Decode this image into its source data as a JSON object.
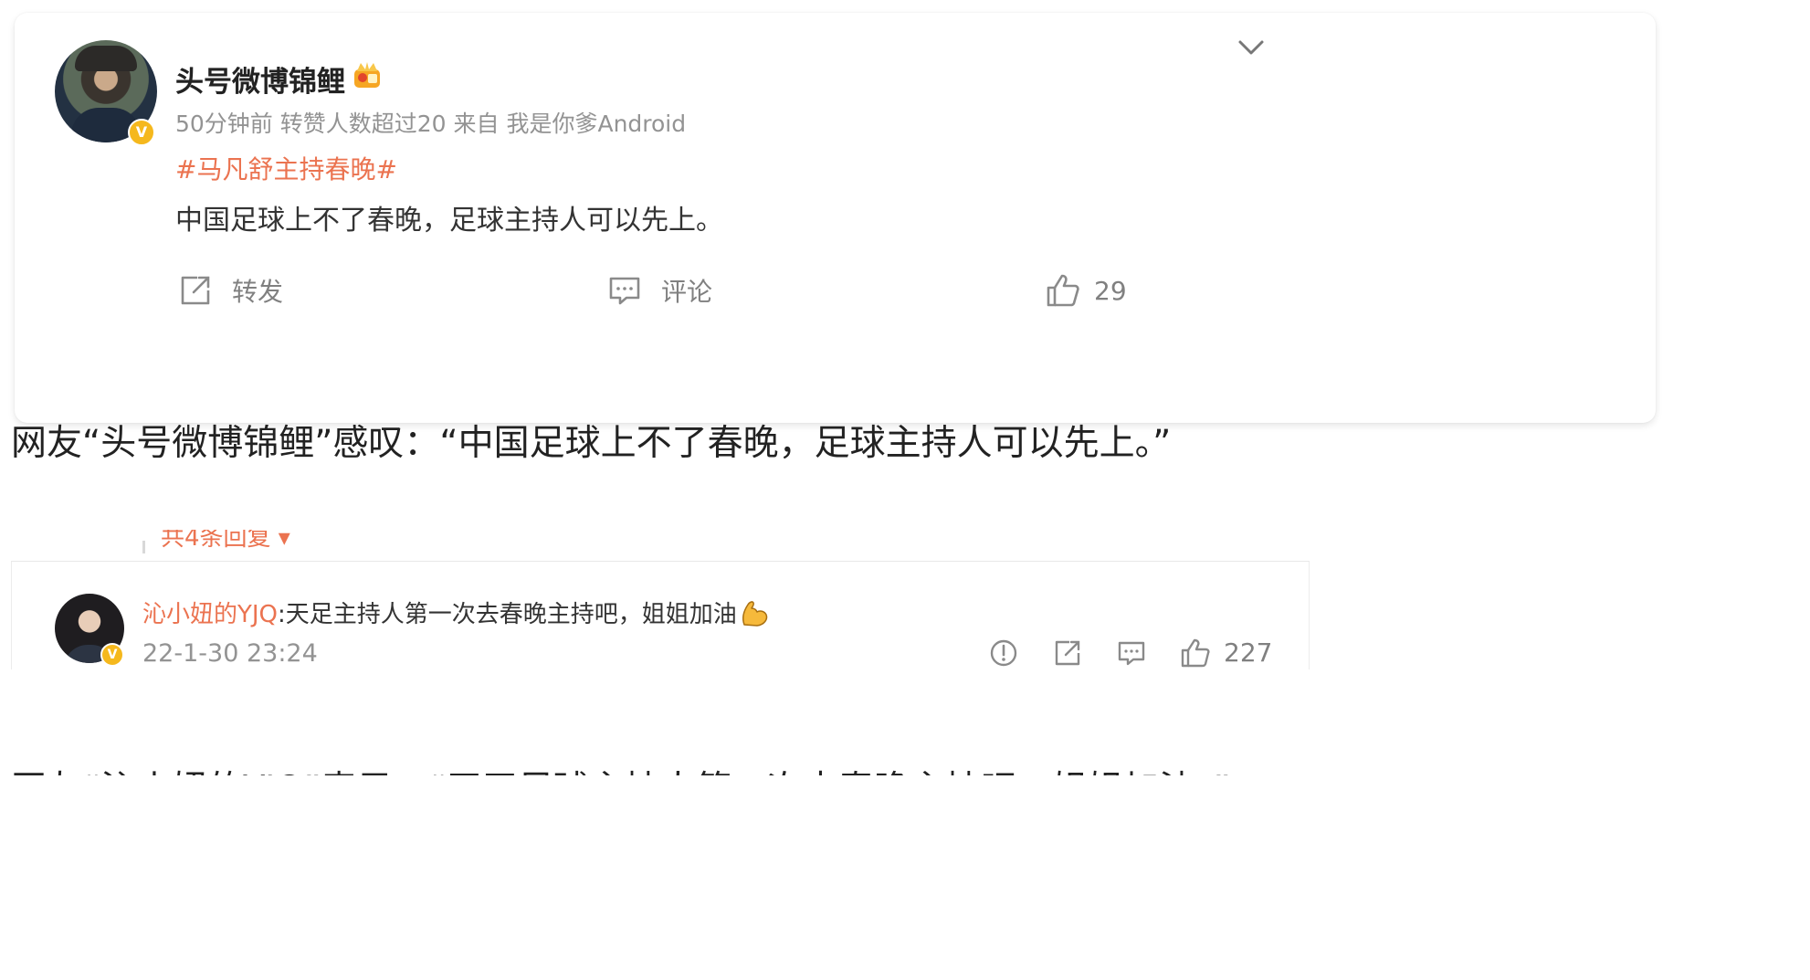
{
  "post": {
    "username": "头号微博锦鲤",
    "meta": "50分钟前  转赞人数超过20   来自 我是你爹Android",
    "hashtag": "#马凡舒主持春晚#",
    "content": "中国足球上不了春晚，足球主持人可以先上。",
    "actions": {
      "repost_label": "转发",
      "comment_label": "评论",
      "like_count": "29"
    },
    "verified_badge": "V"
  },
  "article": {
    "paragraph1": "网友“头号微博锦鲤”感叹：“中国足球上不了春晚，足球主持人可以先上。”",
    "paragraph2": "网友“沁小妞的YJQ”表示：“天天足球主持人第一次去春晚主持吧，姐姐加油。”"
  },
  "comment": {
    "cut_header": "共4条回复 ▾",
    "username": "沁小妞的YJQ",
    "text": ":天足主持人第一次去春晚主持吧，姐姐加油",
    "time": "22-1-30 23:24",
    "like_count": "227",
    "verified_badge": "V"
  },
  "colors": {
    "accent_orange": "#eb7350",
    "meta_gray": "#939393",
    "badge_gold": "#f5b81d"
  },
  "icons": [
    "crown-badge-icon",
    "chevron-down-icon",
    "repost-icon",
    "comment-icon",
    "like-icon",
    "report-icon",
    "muscle-emoji-icon"
  ]
}
